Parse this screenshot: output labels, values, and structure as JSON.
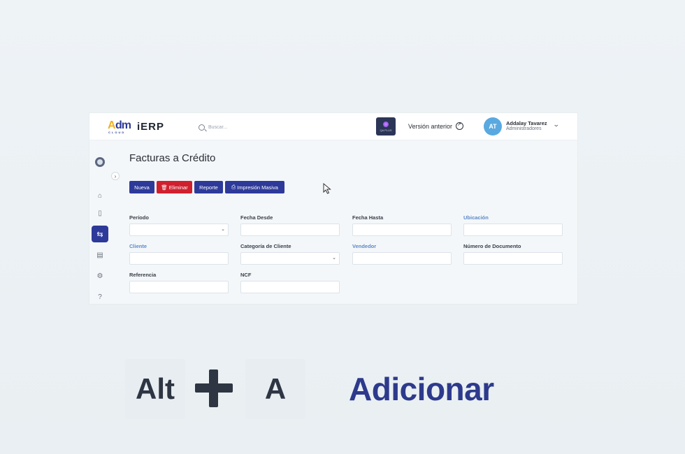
{
  "app": {
    "logo_text_a": "A",
    "logo_text_dm": "dm",
    "logo_cloud": "CLOUD",
    "logo_product": "iERP",
    "search_placeholder": "Buscar...",
    "env_badge": "QA PLUS",
    "previous_version": "Versión anterior",
    "user": {
      "initials": "AT",
      "name": "Addalay Tavarez",
      "role": "Administradores"
    }
  },
  "sidebar": {
    "items": [
      {
        "icon": "home-icon"
      },
      {
        "icon": "book-icon"
      },
      {
        "icon": "transfer-icon",
        "active": true
      },
      {
        "icon": "report-icon"
      },
      {
        "icon": "settings-icon"
      },
      {
        "icon": "help-icon"
      }
    ]
  },
  "page": {
    "title": "Facturas a Crédito",
    "buttons": {
      "new": "Nueva",
      "delete": "Eliminar",
      "report": "Reporte",
      "mass_print": "Impresión Masiva"
    },
    "filters": {
      "periodo": "Período",
      "fecha_desde": "Fecha Desde",
      "fecha_hasta": "Fecha Hasta",
      "ubicacion": "Ubicación",
      "cliente": "Cliente",
      "categoria_cliente": "Categoría de Cliente",
      "vendedor": "Vendedor",
      "numero_documento": "Número de Documento",
      "referencia": "Referencia",
      "ncf": "NCF"
    }
  },
  "shortcut": {
    "key1": "Alt",
    "key2": "A",
    "action": "Adicionar"
  },
  "colors": {
    "primary": "#2d3a9a",
    "danger": "#d0202e",
    "link_label": "#5e88c8",
    "avatar": "#59a9e0"
  }
}
